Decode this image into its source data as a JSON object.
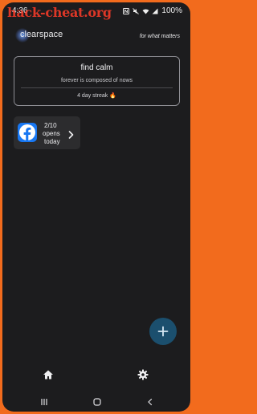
{
  "status_bar": {
    "time": "4:36",
    "battery": "100%",
    "watermark": "hack-cheat.org",
    "icons": [
      "nfc-icon",
      "mute-icon",
      "wifi-icon",
      "signal-icon"
    ]
  },
  "header": {
    "logo": "clearspace",
    "tagline": "for what matters"
  },
  "card": {
    "title": "find calm",
    "subtitle": "forever is composed of nows",
    "streak": "4 day streak 🔥"
  },
  "app_tile": {
    "icon": "facebook-icon",
    "count": "2/10",
    "label1": "opens",
    "label2": "today"
  },
  "fab": {
    "icon": "plus-icon"
  },
  "bottom_nav": {
    "items": [
      "home-icon",
      "settings-icon"
    ]
  },
  "system_nav": {
    "items": [
      "recent-apps-icon",
      "home-circle-icon",
      "back-icon"
    ]
  },
  "colors": {
    "frame": "#f26b1d",
    "background": "#1c1c1e",
    "fab": "#1b4f6e",
    "facebook": "#1877f2"
  }
}
